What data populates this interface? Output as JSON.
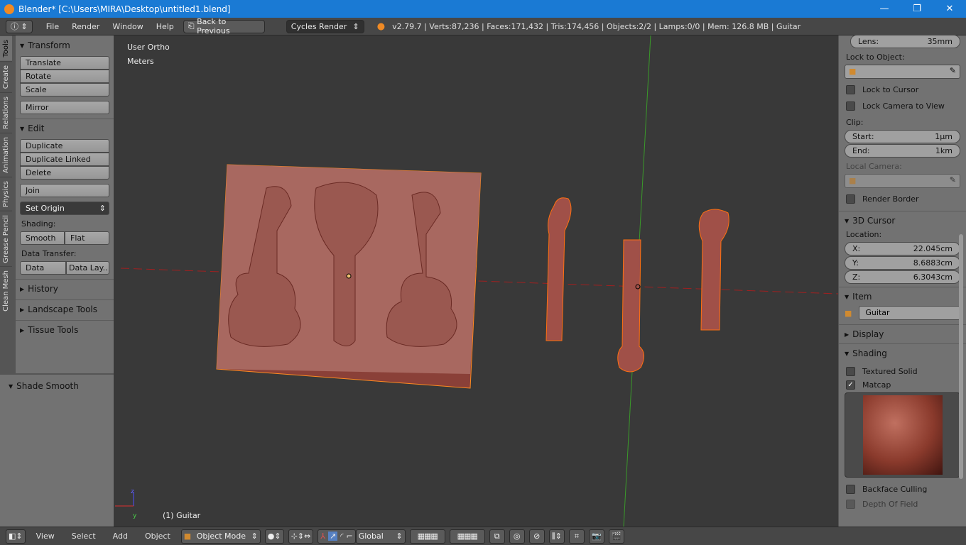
{
  "window": {
    "title": "Blender* [C:\\Users\\MIRA\\Desktop\\untitled1.blend]",
    "minimize": "—",
    "maximize": "❐",
    "close": "✕"
  },
  "topbar": {
    "menus": [
      "File",
      "Render",
      "Window",
      "Help"
    ],
    "back_button": "Back to Previous",
    "render_engine": "Cycles Render",
    "stats": "v2.79.7 | Verts:87,236 | Faces:171,432 | Tris:174,456 | Objects:2/2 | Lamps:0/0 | Mem: 126.8 MB | Guitar"
  },
  "tabs": [
    "Tools",
    "Create",
    "Relations",
    "Animation",
    "Physics",
    "Grease Pencil",
    "Clean Mesh"
  ],
  "tools": {
    "transform": "Transform",
    "translate": "Translate",
    "rotate": "Rotate",
    "scale": "Scale",
    "mirror": "Mirror",
    "edit": "Edit",
    "duplicate": "Duplicate",
    "duplicate_linked": "Duplicate Linked",
    "delete": "Delete",
    "join": "Join",
    "set_origin": "Set Origin",
    "shading_label": "Shading:",
    "smooth": "Smooth",
    "flat": "Flat",
    "data_transfer_label": "Data Transfer:",
    "data": "Data",
    "data_layout": "Data Lay..",
    "history": "History",
    "landscape_tools": "Landscape Tools",
    "tissue_tools": "Tissue Tools",
    "shade_smooth": "Shade Smooth"
  },
  "viewport": {
    "view_name": "User Ortho",
    "units": "Meters",
    "object_label": "(1) Guitar",
    "axis_z": "z",
    "axis_y": "y"
  },
  "right": {
    "lens_label": "Lens:",
    "lens_value": "35mm",
    "lock_to_object": "Lock to Object:",
    "lock_to_cursor": "Lock to Cursor",
    "lock_camera": "Lock Camera to View",
    "clip": "Clip:",
    "start_label": "Start:",
    "start_value": "1µm",
    "end_label": "End:",
    "end_value": "1km",
    "local_camera": "Local Camera:",
    "render_border": "Render Border",
    "cursor_header": "3D Cursor",
    "location": "Location:",
    "x_label": "X:",
    "x_value": "22.045cm",
    "y_label": "Y:",
    "y_value": "8.6883cm",
    "z_label": "Z:",
    "z_value": "6.3043cm",
    "item_header": "Item",
    "item_name": "Guitar",
    "display_header": "Display",
    "shading_header": "Shading",
    "textured_solid": "Textured Solid",
    "matcap": "Matcap",
    "backface_culling": "Backface Culling",
    "depth_of_field": "Depth Of Field"
  },
  "bottombar": {
    "menus": [
      "View",
      "Select",
      "Add",
      "Object"
    ],
    "mode": "Object Mode",
    "orientation": "Global"
  }
}
